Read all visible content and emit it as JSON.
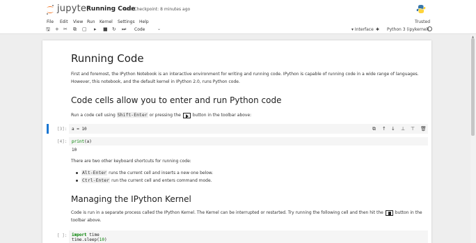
{
  "header": {
    "brand": "jupyter",
    "notebook_title": "Running Code",
    "checkpoint": "Last Checkpoint: 8 minutes ago",
    "trusted": "Trusted"
  },
  "menu": [
    "File",
    "Edit",
    "View",
    "Run",
    "Kernel",
    "Settings",
    "Help"
  ],
  "toolbar": {
    "cell_type": "Code",
    "interface": "Interface",
    "kernel": "Python 3 (ipykernel)"
  },
  "content": {
    "title": "Running Code",
    "intro": "First and foremost, the IPython Notebook is an interactive environment for writing and running code. IPython is capable of running code in a wide range of languages. However, this notebook, and the default kernel in IPython 2.0, runs Python code.",
    "section1": "Code cells allow you to enter and run Python code",
    "run_text_pre": "Run a code cell using",
    "run_key": "Shift-Enter",
    "run_text_mid": "or pressing the",
    "run_text_post": "button in the toolbar above:",
    "cell3_prompt": "[3]:",
    "cell3_code": "a = 10",
    "cell4_prompt": "[4]:",
    "cell4_code": "print(a)",
    "cell4_output": "10",
    "shortcuts_intro": "There are two other keyboard shortcuts for running code:",
    "shortcut1_key": "Alt-Enter",
    "shortcut1_text": "runs the current cell and inserts a new one below.",
    "shortcut2_key": "Ctrl-Enter",
    "shortcut2_text": "run the current cell and enters command mode.",
    "section2": "Managing the IPython Kernel",
    "kernel_text_pre": "Code is run in a separate process called the IPython Kernel. The Kernel can be interrupted or restarted. Try running the following cell and then hit the",
    "kernel_text_post": "button in the toolbar",
    "kernel_text_line2": "above.",
    "cell5_prompt": "[ ]:",
    "cell5_line1_kw": "import",
    "cell5_line1_mod": " time",
    "cell5_line2_obj": "time.sleep(",
    "cell5_line2_num": "10",
    "cell5_line2_end": ")"
  },
  "colors": {
    "active_cell": "#1976d2",
    "jupyter_orange": "#f37726"
  }
}
